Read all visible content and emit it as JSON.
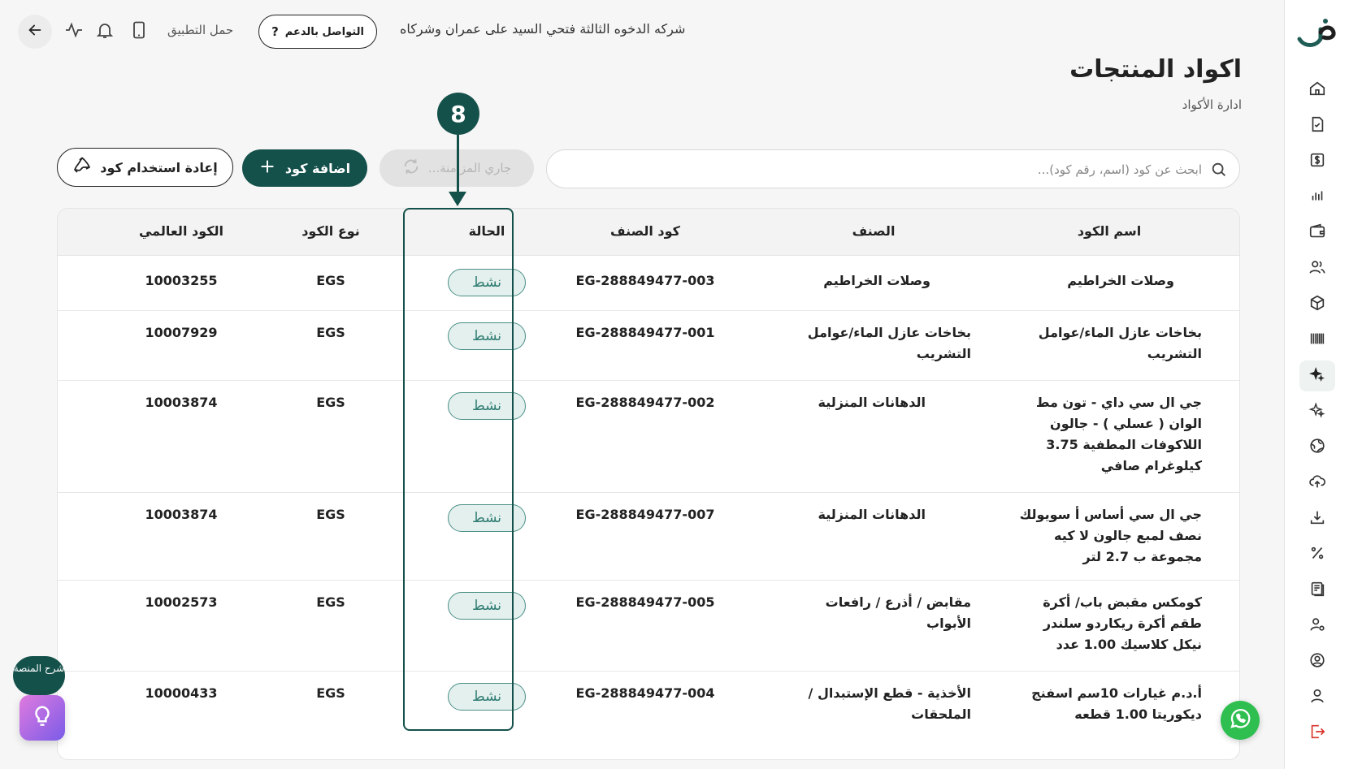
{
  "header": {
    "company_name": "شركه الدخوه الثالثة فتحي السيد على عمران وشركاه",
    "support_label": "التواصل بالدعم",
    "download_app_label": "حمل التطبيق"
  },
  "page": {
    "title": "اكواد المنتجات",
    "subtitle": "ادارة الأكواد"
  },
  "toolbar": {
    "search_placeholder": "ابحث عن كود (اسم، رقم كود)...",
    "sync_label": "جاري المزامنة...",
    "add_label": "اضافة كود",
    "reuse_label": "إعادة استخدام كود"
  },
  "annotation": {
    "step_number": "8"
  },
  "table": {
    "headers": {
      "name": "اسم الكود",
      "category": "الصنف",
      "item_code": "كود الصنف",
      "status": "الحالة",
      "code_type": "نوع الكود",
      "global_code": "الكود العالمي"
    },
    "rows": [
      {
        "name": "وصلات الخراطيم",
        "category": "وصلات الخراطيم",
        "item_code": "EG-288849477-003",
        "status": "نشط",
        "code_type": "EGS",
        "global_code": "10003255"
      },
      {
        "name": "بخاخات عازل الماء/عوامل التشريب",
        "category": "بخاخات عازل الماء/عوامل التشريب",
        "item_code": "EG-288849477-001",
        "status": "نشط",
        "code_type": "EGS",
        "global_code": "10007929"
      },
      {
        "name": "جي ال سي داي - تون مط الوان ( عسلي ) - جالون اللاكوفات المطفية 3.75 كيلوغرام صافي",
        "category": "الدهانات المنزلية",
        "item_code": "EG-288849477-002",
        "status": "نشط",
        "code_type": "EGS",
        "global_code": "10003874"
      },
      {
        "name": "جي ال سي أساس أ سويولك نصف لمبع جالون لا كيه مجموعة ب 2.7 لتر",
        "category": "الدهانات المنزلية",
        "item_code": "EG-288849477-007",
        "status": "نشط",
        "code_type": "EGS",
        "global_code": "10003874"
      },
      {
        "name": "كومكس مقبض باب/ أكرة طقم أكرة ريكاردو سلندر نيكل كلاسيك 1.00 عدد",
        "category": "مقابض / أذرع / رافعات الأبواب",
        "item_code": "EG-288849477-005",
        "status": "نشط",
        "code_type": "EGS",
        "global_code": "10002573"
      },
      {
        "name": "أ.د.م غيارات 10سم اسفنج ديكوريتا 1.00 قطعه",
        "category": "الأخذية - قطع الإستبدال / الملحقات",
        "item_code": "EG-288849477-004",
        "status": "نشط",
        "code_type": "EGS",
        "global_code": "10000433"
      }
    ]
  },
  "widgets": {
    "explain_label": "شرح المنصة"
  },
  "colors": {
    "brand": "#15514b",
    "status_bg": "#e3f0ee",
    "status_text": "#2f7c72",
    "whatsapp": "#2fbf50"
  },
  "sidebar": {
    "icons": [
      "home-icon",
      "invoice-icon",
      "dollar-icon",
      "chart-icon",
      "wallet-icon",
      "users-icon",
      "box-icon",
      "barcode-icon",
      "sparkle-icon",
      "sparkle-outline-icon",
      "globe-icon",
      "cloud-upload-icon",
      "download-icon",
      "percent-icon",
      "report-icon",
      "user-settings-icon",
      "user-circle-icon",
      "user-icon",
      "logout-icon"
    ],
    "active_index": 8
  }
}
